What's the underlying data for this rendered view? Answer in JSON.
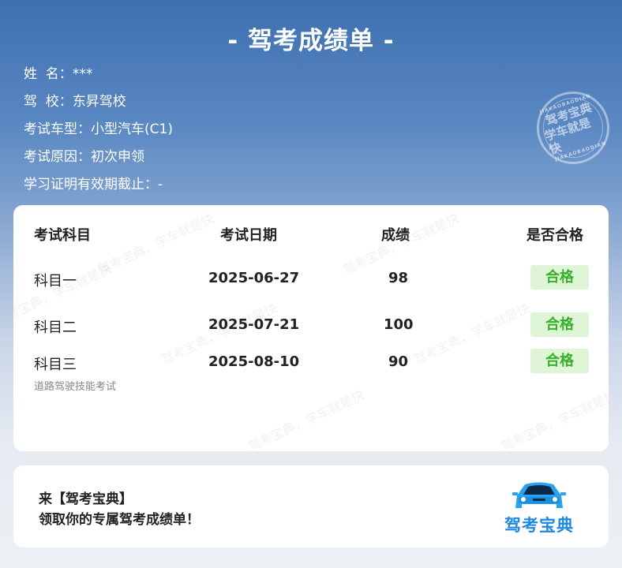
{
  "title": "- 驾考成绩单 -",
  "info": {
    "name_label": "姓  名：",
    "name_value": "***",
    "school_label": "驾  校：",
    "school_value": "东昇驾校",
    "car_label": "考试车型：",
    "car_value": "小型汽车(C1)",
    "reason_label": "考试原因：",
    "reason_value": "初次申领",
    "permit_label": "学习证明有效期截止：",
    "permit_value": "-"
  },
  "seal": {
    "line1": "驾考宝典",
    "line2": "学车就是快",
    "top_text": "JIAKAOBAODIAN",
    "bottom_text": "JIAKAOBAODIAN"
  },
  "watermark": "驾考宝典，学车就是快",
  "table": {
    "headers": [
      "考试科目",
      "考试日期",
      "成绩",
      "是否合格"
    ],
    "rows": [
      {
        "subject": "科目一",
        "date": "2025-06-27",
        "score": "98",
        "result": "合格",
        "note": ""
      },
      {
        "subject": "科目二",
        "date": "2025-07-21",
        "score": "100",
        "result": "合格",
        "note": ""
      },
      {
        "subject": "科目三",
        "date": "2025-08-10",
        "score": "90",
        "result": "合格",
        "note": "道路驾驶技能考试"
      }
    ]
  },
  "promo": {
    "line1": "来【驾考宝典】",
    "line2": "领取你的专属驾考成绩单！",
    "logo_text": "驾考宝典"
  },
  "colors": {
    "pass_bg": "#dff5d8",
    "pass_text": "#38b02b",
    "logo_blue": "#1e88e5"
  }
}
